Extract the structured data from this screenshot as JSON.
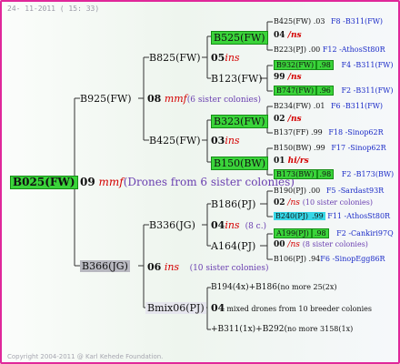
{
  "header": {
    "date": "24- 11-2011 ( 15: 33)"
  },
  "footer": {
    "copyright": "Copyright 2004-2011 @ Karl Kehede Foundation."
  },
  "root": {
    "id": "B025(FW)",
    "year": "09",
    "mark": "mmf",
    "note": "(Drones from 6 sister colonies)"
  },
  "mother": {
    "id": "B925(FW)",
    "year": "08",
    "mark": "mmf",
    "note": "(6 sister colonies)"
  },
  "father": {
    "id": "B366(JG)",
    "year": "06",
    "mark": "ins",
    "note": "(10 sister colonies)"
  },
  "mm": {
    "id": "B825(FW)",
    "year": "05",
    "mark": "ins"
  },
  "mf": {
    "id": "B425(FW)",
    "year": "03",
    "mark": "ins"
  },
  "fm": {
    "id": "B336(JG)",
    "year": "04",
    "mark": "ins",
    "note": "(8 c.)"
  },
  "ff": {
    "id": "Bmix06(PJ)",
    "year": "04",
    "note": "mixed drones from 10 breeder colonies"
  },
  "mmm": {
    "id": "B525(FW)",
    "year": "04",
    "mark": "/ns"
  },
  "mmf": {
    "id": "B123(FW)",
    "year": "99",
    "mark": "/ns"
  },
  "mfm": {
    "id": "B323(FW)",
    "year": "02",
    "mark": "/ns"
  },
  "mff": {
    "id": "B150(BW)",
    "year": "01",
    "mark": "hi/rs"
  },
  "fmm": {
    "id": "B186(PJ)",
    "year": "02",
    "mark": "/ns",
    "note": "(10 sister colonies)"
  },
  "fmf": {
    "id": "A164(PJ)",
    "year": "00",
    "mark": "/ns",
    "note": "(8 sister colonies)"
  },
  "ffm": {
    "text": "B194(4x)+B186(",
    "suffix": "no more 25(2x)"
  },
  "fff": {
    "text": "+B311(1x)+B292(",
    "suffix": "no more 3158(1x)"
  },
  "leaves": [
    {
      "id": "B425(FW)",
      "year": ".03",
      "ref": "F8 -B311(FW)"
    },
    {
      "id": "B223(PJ)",
      "year": ".00",
      "ref": "F12 -AthosSt80R"
    },
    {
      "id": "B932(FW)",
      "year": ".98",
      "ref": "F4 -B311(FW)"
    },
    {
      "id": "B747(FW)",
      "year": ".96",
      "ref": "F2 -B311(FW)"
    },
    {
      "id": "B234(FW)",
      "year": ".01",
      "ref": "F6 -B311(FW)"
    },
    {
      "id": "B137(FF)",
      "year": ".99",
      "ref": "F18 -Sinop62R"
    },
    {
      "id": "B150(BW)",
      "year": ".99",
      "ref": "F17 -Sinop62R"
    },
    {
      "id": "B173(BW)",
      "year": ".98",
      "ref": "F2 -B173(BW)"
    },
    {
      "id": "B190(PJ)",
      "year": ".00",
      "ref": "F5 -Sardast93R"
    },
    {
      "id": "B240(PJ)",
      "year": ".99",
      "ref": "F11 -AthosSt80R"
    },
    {
      "id": "A199(PJ)",
      "year": ".98",
      "ref": "F2 -Cankiri97Q"
    },
    {
      "id": "B106(PJ)",
      "year": ".94",
      "ref": "F6 -SinopEgg86R"
    }
  ]
}
